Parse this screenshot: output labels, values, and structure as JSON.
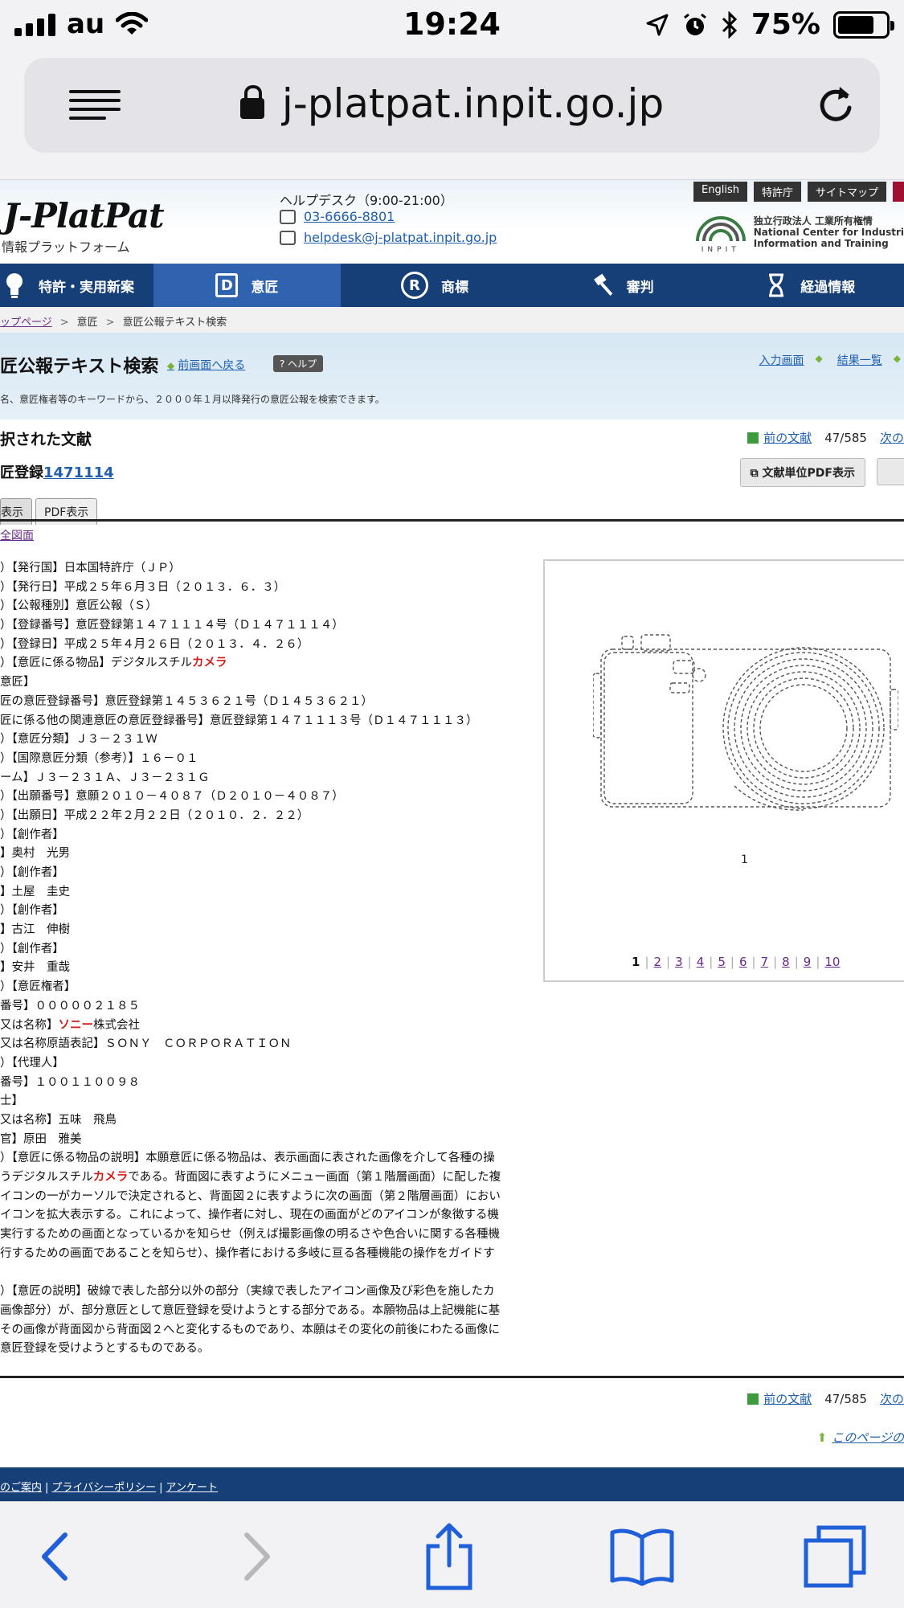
{
  "status_bar": {
    "carrier": "au",
    "time": "19:24",
    "battery_percent": "75%",
    "battery_level": 0.75
  },
  "browser": {
    "url": "j-platpat.inpit.go.jp"
  },
  "header": {
    "logo": "J-PlatPat",
    "logo_sub": "情報プラットフォーム",
    "helpdesk": "ヘルプデスク（9:00-21:00）",
    "phone": "03-6666-8801",
    "email": "helpdesk@j-platpat.inpit.go.jp",
    "top_links": [
      "English",
      "特許庁",
      "サイトマップ"
    ],
    "inpit_mark": "INPIT",
    "inpit_lines": [
      "独立行政法人 工業所有権情",
      "National Center for Industri",
      "Information and Training"
    ]
  },
  "nav": {
    "items": [
      {
        "label": "特許・実用新案",
        "icon": "bulb-icon"
      },
      {
        "label": "意匠",
        "icon": "d-icon"
      },
      {
        "label": "商標",
        "icon": "r-icon"
      },
      {
        "label": "審判",
        "icon": "gavel-icon"
      },
      {
        "label": "経過情報",
        "icon": "hourglass-icon"
      }
    ],
    "glyphs": {
      "design": "D",
      "trademark": "R"
    }
  },
  "breadcrumb": {
    "items": [
      "ップページ",
      "意匠",
      "意匠公報テキスト検索"
    ],
    "separator": ">"
  },
  "banner": {
    "title": "匠公報テキスト検索",
    "back_label": "前画面へ戻る",
    "help_label": "? ヘルプ",
    "input_link": "入力画面",
    "results_link": "結果一覧",
    "description": "名、意匠権者等のキーワードから、２０００年１月以降発行の意匠公報を検索できます。"
  },
  "document": {
    "section_title": "択された文献",
    "reg_prefix": "匠登録",
    "reg_number": "1471114",
    "prev_label": "前の文献",
    "position": "47/585",
    "next_label": "次の",
    "pdf_button": "文献単位PDF表示",
    "tabs": [
      "表示",
      "PDF表示"
    ],
    "all_figs_link": "全図面",
    "bib_lines": [
      {
        "t": "）【発行国】日本国特許庁（ＪＰ）"
      },
      {
        "t": "）【発行日】平成２５年６月３日（２０１３．６．３）"
      },
      {
        "t": "）【公報種別】意匠公報（Ｓ）"
      },
      {
        "t": "）【登録番号】意匠登録第１４７１１１４号（Ｄ１４７１１１４）"
      },
      {
        "t": "）【登録日】平成２５年４月２６日（２０１３．４．２６）"
      },
      {
        "t": "）【意匠に係る物品】デジタルスチル",
        "h": "カメラ"
      },
      {
        "t": "意匠】"
      },
      {
        "t": "匠の意匠登録番号】意匠登録第１４５３６２１号（Ｄ１４５３６２１）"
      },
      {
        "t": "匠に係る他の関連意匠の意匠登録番号】意匠登録第１４７１１１３号（Ｄ１４７１１１３）"
      },
      {
        "t": "）【意匠分類】Ｊ３－２３１Ｗ"
      },
      {
        "t": "）【国際意匠分類（参考）】１６－０１"
      },
      {
        "t": "ーム】Ｊ３－２３１Ａ、Ｊ３－２３１Ｇ"
      },
      {
        "t": "）【出願番号】意願２０１０－４０８７（Ｄ２０１０－４０８７）"
      },
      {
        "t": "）【出願日】平成２２年２月２２日（２０１０．２．２２）"
      },
      {
        "t": "）【創作者】"
      },
      {
        "t": "】奥村　光男"
      },
      {
        "t": "）【創作者】"
      },
      {
        "t": "】土屋　圭史"
      },
      {
        "t": "）【創作者】"
      },
      {
        "t": "】古江　伸樹"
      },
      {
        "t": "）【創作者】"
      },
      {
        "t": "】安井　重哉"
      },
      {
        "t": "）【意匠権者】"
      },
      {
        "t": "番号】０００００２１８５"
      },
      {
        "t": "又は名称】",
        "h": "ソニー",
        "a": "株式会社"
      },
      {
        "t": "又は名称原語表記】ＳＯＮＹ　ＣＯＲＰＯＲＡＴＩＯＮ"
      },
      {
        "t": "）【代理人】"
      },
      {
        "t": "番号】１００１１００９８"
      },
      {
        "t": "士】"
      },
      {
        "t": "又は名称】五味　飛鳥"
      },
      {
        "t": "官】原田　雅美"
      },
      {
        "t": "）【意匠に係る物品の説明】本願意匠に係る物品は、表示画面に表された画像を介して各種の操"
      },
      {
        "t": "うデジタルスチル",
        "h": "カメラ",
        "a": "である。背面図に表すようにメニュー画面（第１階層画面）に配した複"
      },
      {
        "t": "イコンの一がカーソルで決定されると、背面図２に表すように次の画面（第２階層画面）におい"
      },
      {
        "t": "イコンを拡大表示する。これによって、操作者に対し、現在の画面がどのアイコンが象徴する機"
      },
      {
        "t": "実行するための画面となっているかを知らせ（例えば撮影画像の明るさや色合いに関する各種機"
      },
      {
        "t": "行するための画面であることを知らせ）、操作者における多岐に亘る各種機能の操作をガイドす"
      },
      {
        "t": ""
      },
      {
        "t": "）【意匠の説明】破線で表した部分以外の部分（実線で表したアイコン画像及び彩色を施したカ"
      },
      {
        "t": "画像部分）が、部分意匠として意匠登録を受けようとする部分である。本願物品は上記機能に基"
      },
      {
        "t": "その画像が背面図から背面図２へと変化するものであり、本願はその変化の前後にわたる画像に"
      },
      {
        "t": "意匠登録を受けようとするものである。"
      }
    ]
  },
  "figure": {
    "label": "1",
    "pages": [
      "1",
      "2",
      "3",
      "4",
      "5",
      "6",
      "7",
      "8",
      "9",
      "10"
    ],
    "current_page": "1"
  },
  "page_top": "このページの",
  "footer": {
    "links": [
      "のご案内",
      "プライバシーポリシー",
      "アンケート"
    ]
  },
  "colors": {
    "nav_bg": "#163f77",
    "nav_active": "#2f63b0",
    "link": "#1f5fae",
    "highlight": "#d0201a",
    "toolbar_icon": "#1f5fd9"
  }
}
